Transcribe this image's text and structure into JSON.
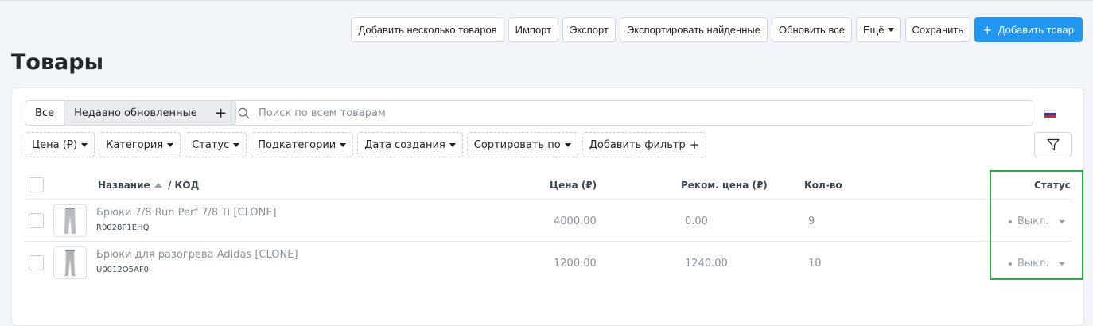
{
  "toolbar": {
    "add_multiple": "Добавить несколько товаров",
    "import": "Импорт",
    "export": "Экспорт",
    "export_found": "Экспортировать найденные",
    "update_all": "Обновить все",
    "more": "Ещё",
    "save": "Сохранить",
    "add_product": "Добавить товар"
  },
  "page": {
    "title": "Товары"
  },
  "tabs": {
    "all": "Все",
    "recent": "Недавно обновленные",
    "add": "+"
  },
  "search": {
    "placeholder": "Поиск по всем товарам",
    "value": ""
  },
  "filters": {
    "price": "Цена (₽)",
    "category": "Категория",
    "status": "Статус",
    "subcategories": "Подкатегории",
    "created": "Дата создания",
    "sort": "Сортировать по",
    "add_filter": "Добавить фильтр"
  },
  "table": {
    "headers": {
      "name": "Название",
      "code": "/ КОД",
      "price": "Цена (₽)",
      "rec_price": "Реком. цена (₽)",
      "qty": "Кол-во",
      "status": "Статус"
    },
    "rows": [
      {
        "name": "Брюки 7/8 Run Perf 7/8 Ti [CLONE]",
        "code": "R0028P1EHQ",
        "price": "4000.00",
        "rec_price": "0.00",
        "qty": "9",
        "status": "Выкл."
      },
      {
        "name": "Брюки для разогрева Adidas [CLONE]",
        "code": "U0012O5AF0",
        "price": "1200.00",
        "rec_price": "1240.00",
        "qty": "10",
        "status": "Выкл."
      }
    ]
  },
  "colors": {
    "primary": "#2196f3",
    "highlight": "#2bb043",
    "background": "#f1f4f8",
    "muted_text": "#8a9099"
  },
  "icons": {
    "search": "search-icon",
    "filter": "funnel-icon",
    "flag": "flag-ru-icon",
    "sort": "sort-asc-icon",
    "plus": "plus-icon"
  }
}
